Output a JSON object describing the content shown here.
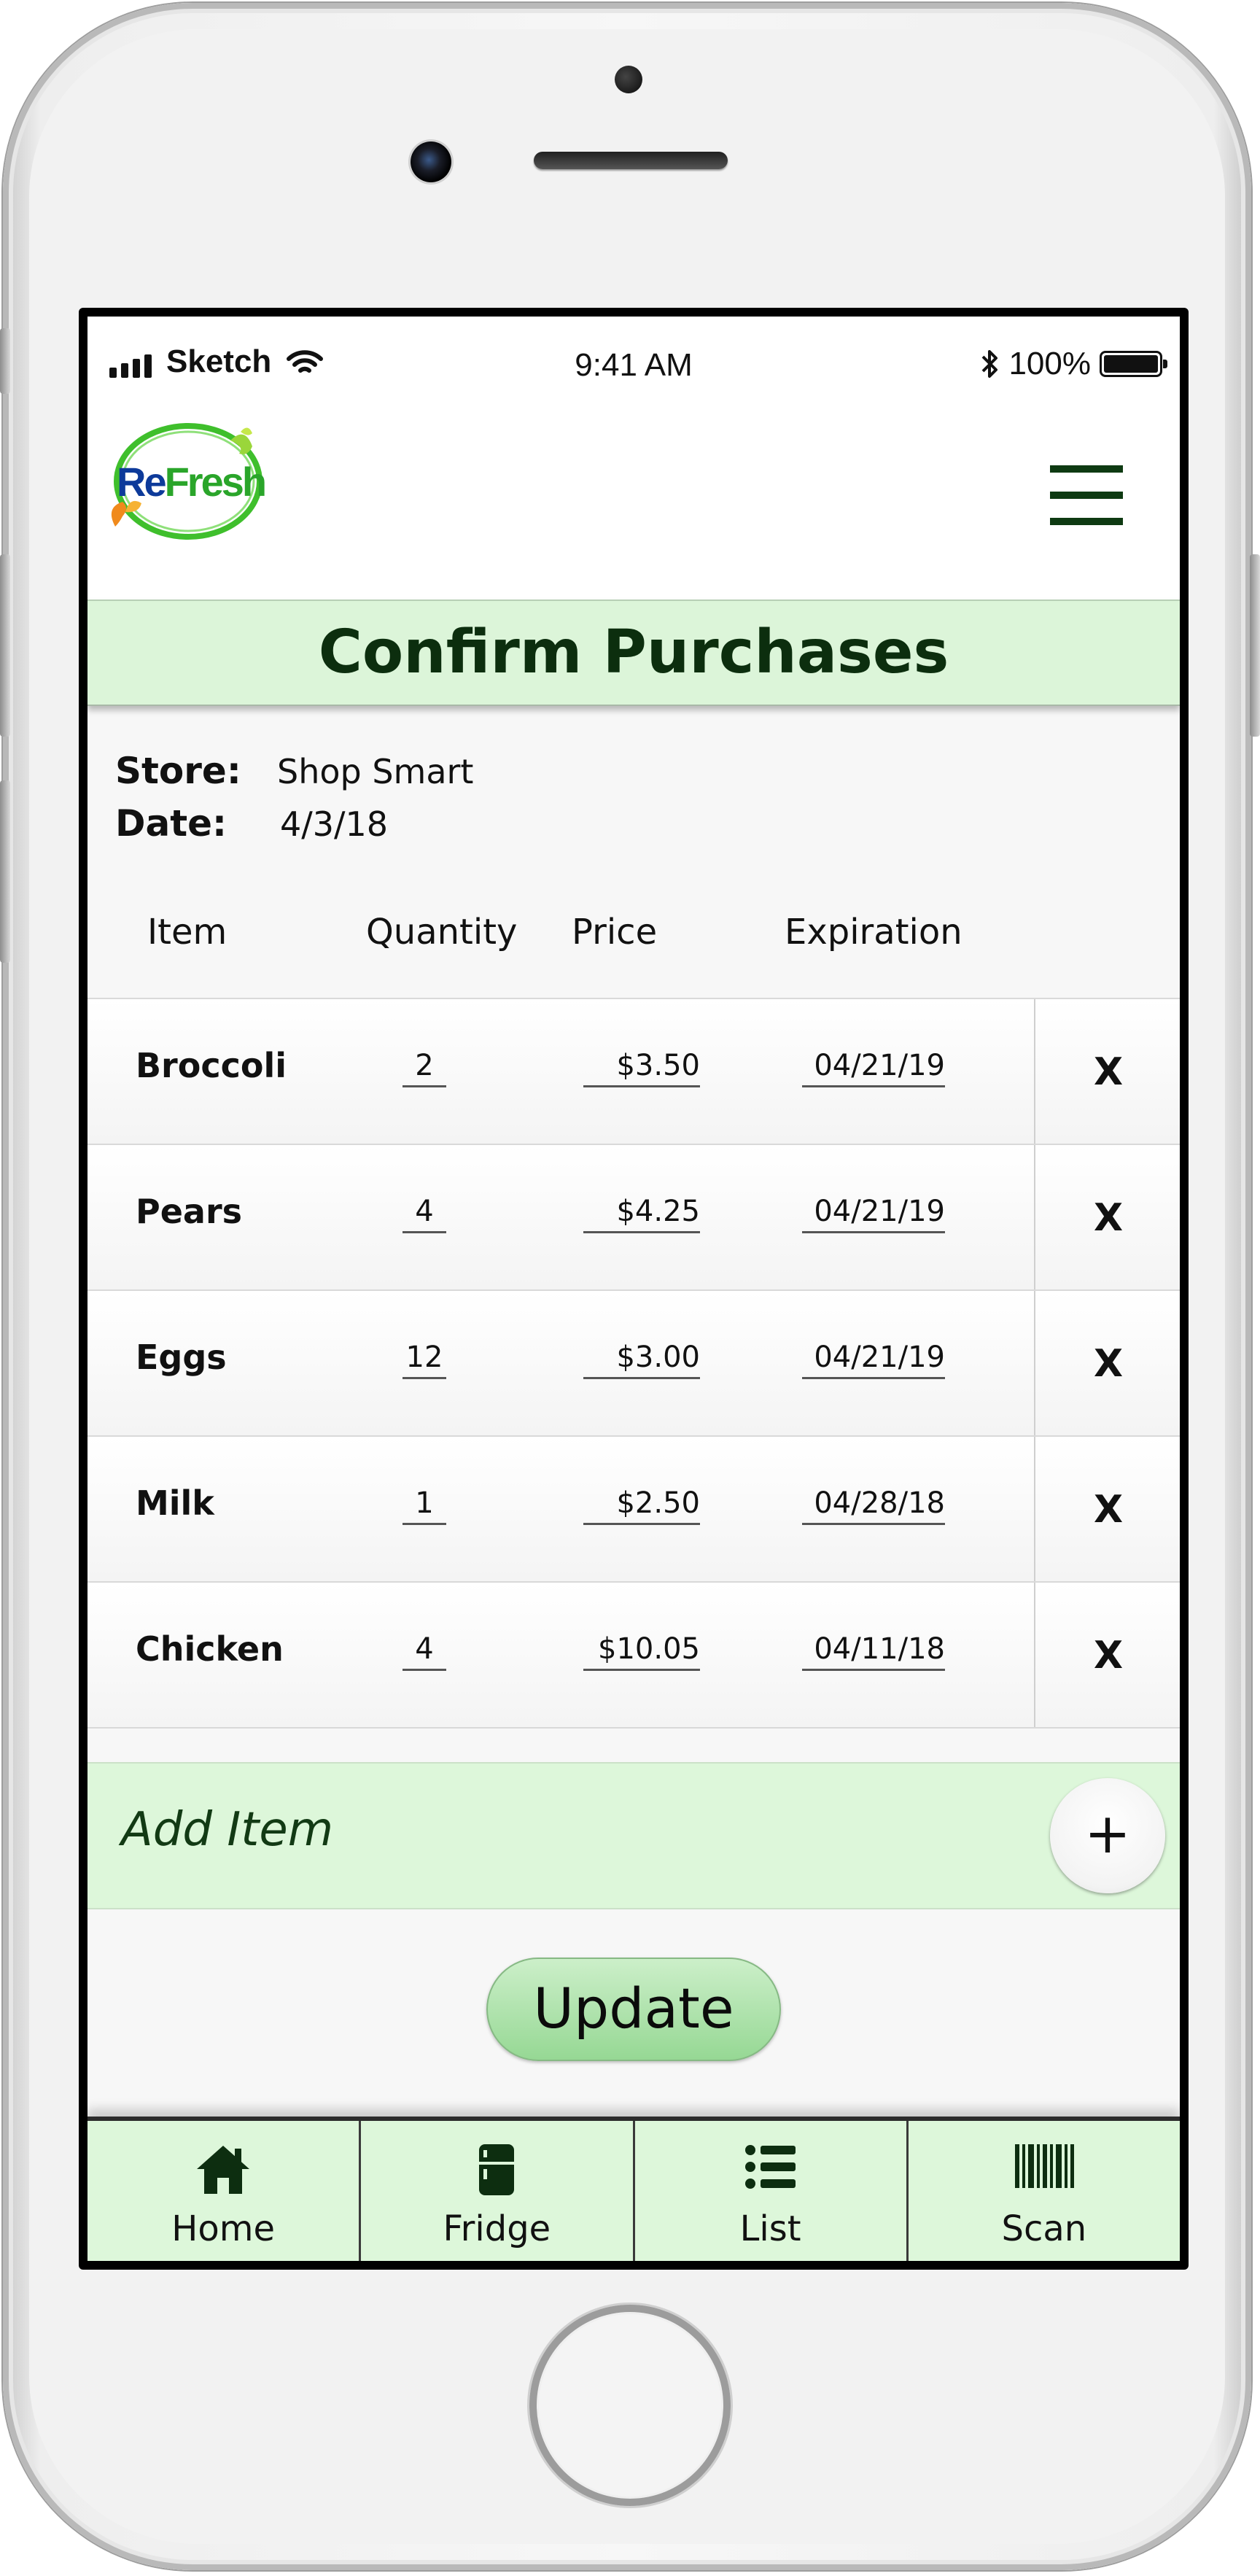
{
  "status_bar": {
    "carrier": "Sketch",
    "time": "9:41 AM",
    "battery": "100%",
    "battery_level": 1.0
  },
  "header": {
    "logo_text": "ReFresh",
    "menu_icon": "hamburger-menu-icon"
  },
  "page": {
    "title": "Confirm Purchases"
  },
  "purchase": {
    "store_label": "Store:",
    "store_value": "Shop Smart",
    "date_label": "Date:",
    "date_value": "4/3/18"
  },
  "table": {
    "columns": [
      "Item",
      "Quantity",
      "Price",
      "Expiration"
    ],
    "rows": [
      {
        "item": "Broccoli",
        "quantity": "2",
        "price": "$3.50",
        "expiration": "04/21/19",
        "remove": "X"
      },
      {
        "item": "Pears",
        "quantity": "4",
        "price": "$4.25",
        "expiration": "04/21/19",
        "remove": "X"
      },
      {
        "item": "Eggs",
        "quantity": "12",
        "price": "$3.00",
        "expiration": "04/21/19",
        "remove": "X"
      },
      {
        "item": "Milk",
        "quantity": "1",
        "price": "$2.50",
        "expiration": "04/28/18",
        "remove": "X"
      },
      {
        "item": "Chicken",
        "quantity": "4",
        "price": "$10.05",
        "expiration": "04/11/18",
        "remove": "X"
      }
    ]
  },
  "add_item": {
    "label": "Add Item",
    "button": "+"
  },
  "update_button": "Update",
  "tabs": [
    {
      "label": "Home",
      "icon": "home-icon"
    },
    {
      "label": "Fridge",
      "icon": "fridge-icon"
    },
    {
      "label": "List",
      "icon": "list-icon"
    },
    {
      "label": "Scan",
      "icon": "barcode-icon"
    }
  ],
  "colors": {
    "accent_green": "#ddf7da",
    "title_green": "#0c2e0e",
    "button_green": "#96d894"
  }
}
